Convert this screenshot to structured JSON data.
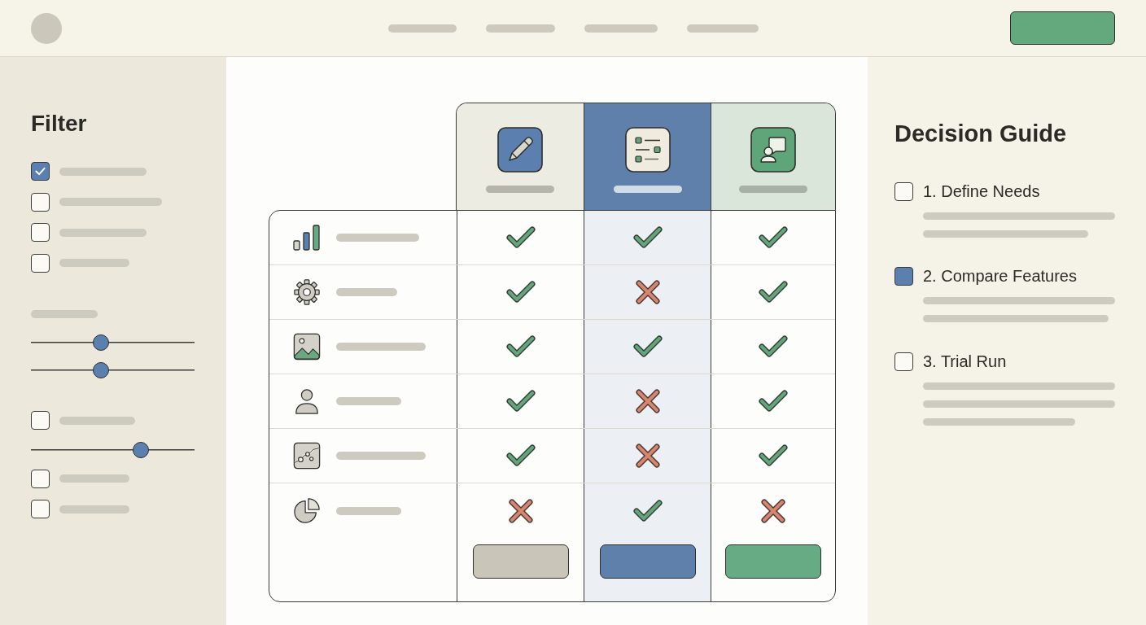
{
  "sidebar": {
    "title": "Filter",
    "groups": [
      {
        "items": [
          {
            "kind": "checkbox",
            "checked": true
          },
          {
            "kind": "checkbox",
            "checked": false
          },
          {
            "kind": "checkbox",
            "checked": false
          },
          {
            "kind": "checkbox",
            "checked": false
          }
        ]
      },
      {
        "items": [
          {
            "kind": "label"
          },
          {
            "kind": "slider",
            "level": 0.43
          },
          {
            "kind": "slider",
            "level": 0.43
          }
        ]
      },
      {
        "items": [
          {
            "kind": "checkbox",
            "checked": false
          },
          {
            "kind": "slider",
            "level": 0.67
          },
          {
            "kind": "checkbox",
            "checked": false
          },
          {
            "kind": "checkbox",
            "checked": false
          }
        ]
      }
    ]
  },
  "comparison": {
    "columns": [
      {
        "selected": false,
        "color": "#c9c6b9"
      },
      {
        "selected": true,
        "color": "#5f80aa"
      },
      {
        "selected": false,
        "color": "#66ab83"
      }
    ],
    "rows": [
      {
        "cells": [
          {
            "available": true
          },
          {
            "available": true
          },
          {
            "available": true
          }
        ]
      },
      {
        "cells": [
          {
            "available": true
          },
          {
            "available": false
          },
          {
            "available": true
          }
        ]
      },
      {
        "cells": [
          {
            "available": true
          },
          {
            "available": true
          },
          {
            "available": true
          }
        ]
      },
      {
        "cells": [
          {
            "available": true
          },
          {
            "available": false
          },
          {
            "available": true
          }
        ]
      },
      {
        "cells": [
          {
            "available": true
          },
          {
            "available": false
          },
          {
            "available": true
          }
        ]
      },
      {
        "cells": [
          {
            "available": false
          },
          {
            "available": true
          },
          {
            "available": false
          }
        ]
      }
    ]
  },
  "guide": {
    "title": "Decision Guide",
    "steps": [
      {
        "label": "1. Define Needs",
        "selected": false
      },
      {
        "label": "2. Compare Features",
        "selected": true
      },
      {
        "label": "3. Trial Run",
        "selected": false
      }
    ]
  }
}
